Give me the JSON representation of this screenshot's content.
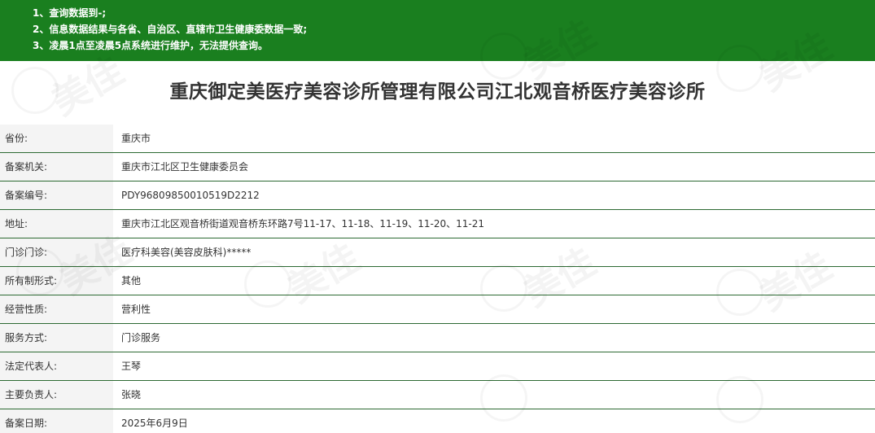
{
  "notice": {
    "lines": [
      "1、查询数据到-;",
      "2、信息数据结果与各省、自治区、直辖市卫生健康委数据一致;",
      "3、凌晨1点至凌晨5点系统进行维护，无法提供查询。"
    ],
    "background_color": "#1a7f1f"
  },
  "title": "重庆御定美医疗美容诊所管理有限公司江北观音桥医疗美容诊所",
  "watermark_text": "美佳",
  "records": [
    {
      "label": "省份:",
      "value": "重庆市"
    },
    {
      "label": "备案机关:",
      "value": "重庆市江北区卫生健康委员会"
    },
    {
      "label": "备案编号:",
      "value": "PDY96809850010519D2212"
    },
    {
      "label": "地址:",
      "value": "重庆市江北区观音桥街道观音桥东环路7号11-17、11-18、11-19、11-20、11-21"
    },
    {
      "label": "门诊门诊:",
      "value": "医疗科美容(美容皮肤科)*****"
    },
    {
      "label": "所有制形式:",
      "value": "其他"
    },
    {
      "label": "经营性质:",
      "value": "营利性"
    },
    {
      "label": "服务方式:",
      "value": "门诊服务"
    },
    {
      "label": "法定代表人:",
      "value": "王琴"
    },
    {
      "label": "主要负责人:",
      "value": "张晓"
    },
    {
      "label": "备案日期:",
      "value": "2025年6月9日"
    }
  ],
  "colors": {
    "row_divider": "#2d6a33",
    "label_background": "#f4f4f4"
  }
}
